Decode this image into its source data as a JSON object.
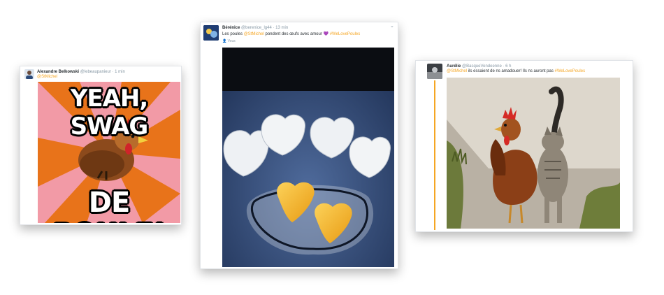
{
  "tweets": [
    {
      "author_name": "Alexandre Belkowski",
      "author_handle": "@lebeaupanieur",
      "time": "· 1 min",
      "mention": "@StMichel",
      "meme_top": "YEAH, SWAG",
      "meme_bottom": "DE POULE!"
    },
    {
      "author_name": "Bérénice",
      "author_handle": "@berenice_lg44",
      "time": "· 13 min",
      "text_before": "Les poules ",
      "mention": "@StMichel",
      "text_after": " pondent des œufs avec amour ",
      "heart": "💜",
      "hashtag": "#WeLovePoules",
      "attribution": "Vous"
    },
    {
      "author_name": "Aurélie",
      "author_handle": "@BasqueVendeenne",
      "time": "· 6 h",
      "mention": "@StMichel",
      "text_after": " ils essaient de ns amadouer! Ils ns auront pas ",
      "hashtag": "#WeLovePoules"
    }
  ],
  "colors": {
    "accent": "#f5a623",
    "meme_orange": "#e8731a",
    "meme_pink": "#f29aa6",
    "egg_blue": "#3f5a87"
  }
}
